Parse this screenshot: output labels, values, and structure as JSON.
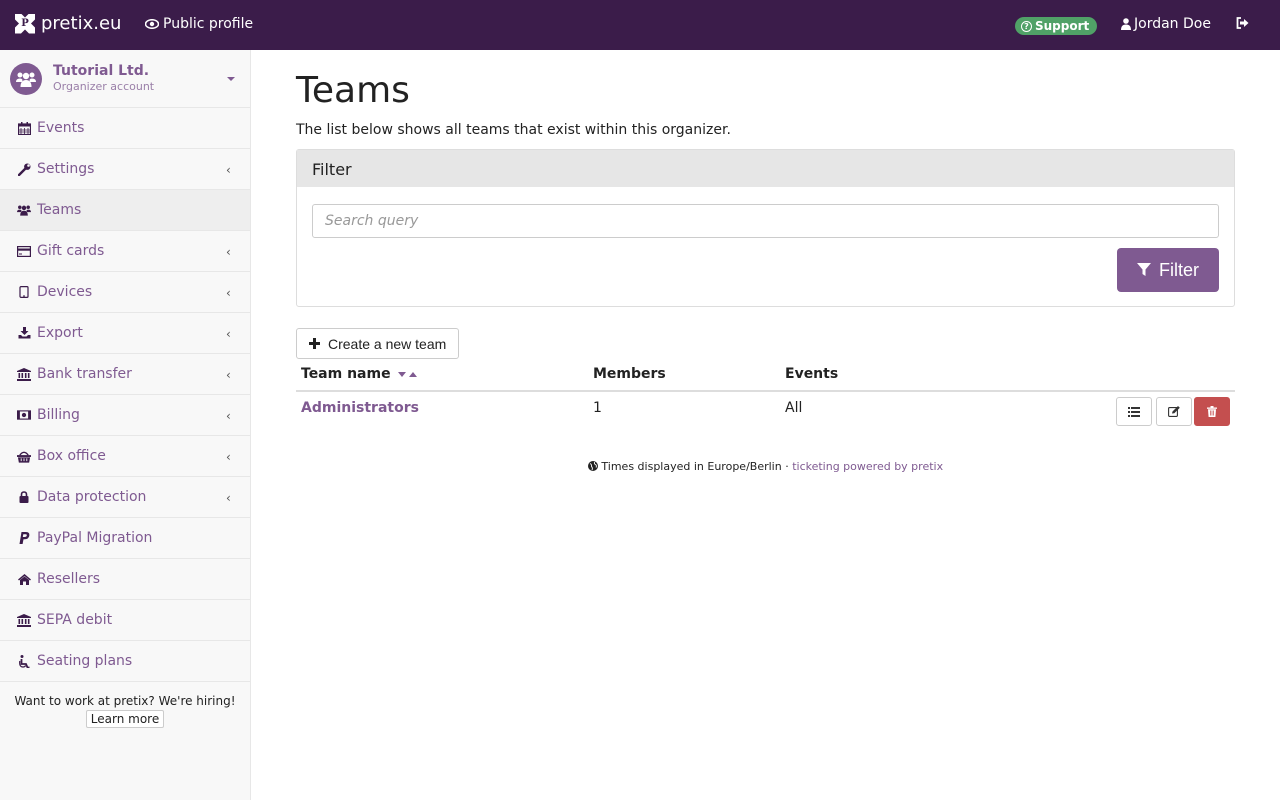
{
  "topbar": {
    "brand": "pretix.eu",
    "public_profile": "Public profile",
    "support": "Support",
    "user": "Jordan Doe"
  },
  "organizer": {
    "name": "Tutorial Ltd.",
    "subtitle": "Organizer account"
  },
  "sidebar": {
    "items": [
      {
        "label": "Events",
        "icon": "calendar-icon",
        "chevron": false,
        "active": false
      },
      {
        "label": "Settings",
        "icon": "wrench-icon",
        "chevron": true,
        "active": false
      },
      {
        "label": "Teams",
        "icon": "users-icon",
        "chevron": false,
        "active": true
      },
      {
        "label": "Gift cards",
        "icon": "credit-card-icon",
        "chevron": true,
        "active": false
      },
      {
        "label": "Devices",
        "icon": "tablet-icon",
        "chevron": true,
        "active": false
      },
      {
        "label": "Export",
        "icon": "download-icon",
        "chevron": true,
        "active": false
      },
      {
        "label": "Bank transfer",
        "icon": "bank-icon",
        "chevron": true,
        "active": false
      },
      {
        "label": "Billing",
        "icon": "money-icon",
        "chevron": true,
        "active": false
      },
      {
        "label": "Box office",
        "icon": "basket-icon",
        "chevron": true,
        "active": false
      },
      {
        "label": "Data protection",
        "icon": "lock-icon",
        "chevron": true,
        "active": false
      },
      {
        "label": "PayPal Migration",
        "icon": "paypal-icon",
        "chevron": false,
        "active": false
      },
      {
        "label": "Resellers",
        "icon": "home-icon",
        "chevron": false,
        "active": false
      },
      {
        "label": "SEPA debit",
        "icon": "bank-icon",
        "chevron": false,
        "active": false
      },
      {
        "label": "Seating plans",
        "icon": "wheelchair-icon",
        "chevron": false,
        "active": false
      }
    ],
    "hiring_text": "Want to work at pretix? We're hiring!",
    "learn_more": "Learn more"
  },
  "main": {
    "title": "Teams",
    "description": "The list below shows all teams that exist within this organizer.",
    "filter": {
      "heading": "Filter",
      "search_placeholder": "Search query",
      "search_value": "",
      "button": "Filter"
    },
    "create_button": "Create a new team",
    "table": {
      "columns": [
        "Team name",
        "Members",
        "Events"
      ],
      "rows": [
        {
          "name": "Administrators",
          "members": "1",
          "events": "All"
        }
      ]
    },
    "footer": {
      "timezone": "Times displayed in Europe/Berlin",
      "separator": " · ",
      "powered": "ticketing powered by pretix"
    }
  },
  "colors": {
    "topbar": "#3b1c4a",
    "accent": "#7f5a91",
    "support": "#50a167",
    "danger": "#c44f4f"
  }
}
